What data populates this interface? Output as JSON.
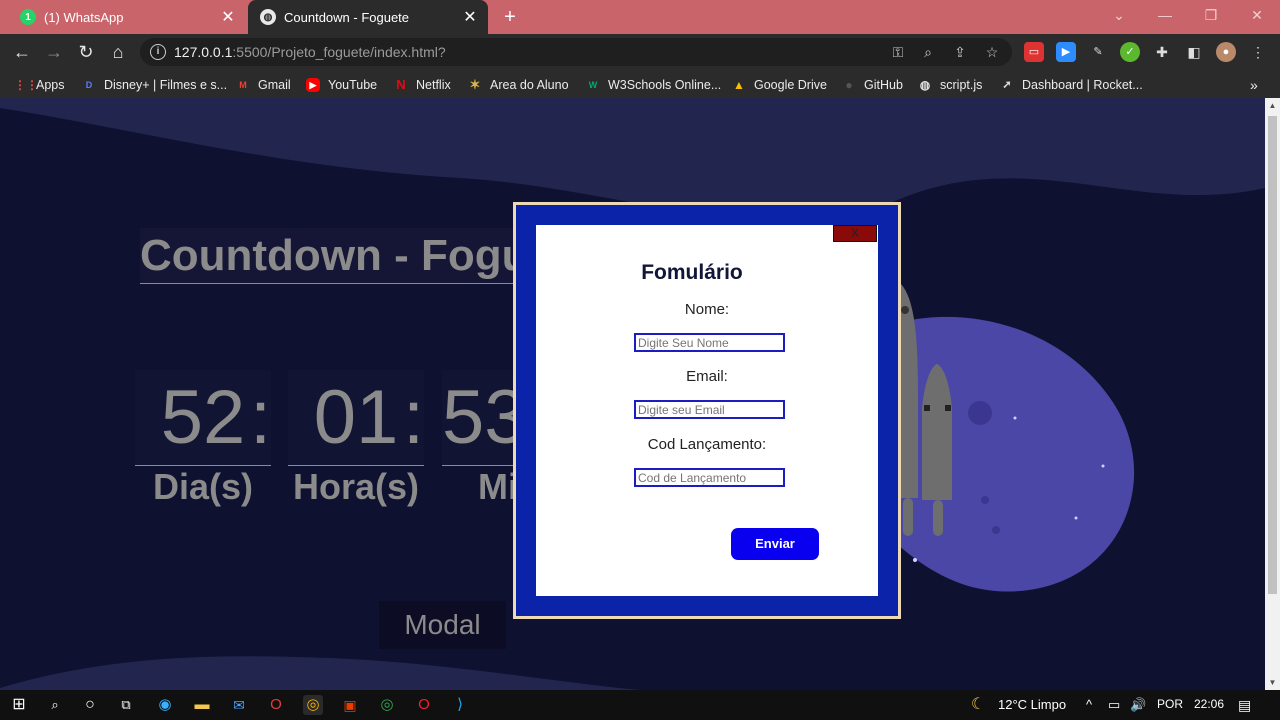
{
  "browser": {
    "tabs": [
      {
        "title": "(1) WhatsApp",
        "icon": "whatsapp-icon",
        "active": false
      },
      {
        "title": "Countdown - Foguete",
        "icon": "globe-icon",
        "active": true
      }
    ],
    "address": {
      "host": "127.0.0.1",
      "path": ":5500/Projeto_foguete/index.html?"
    },
    "bookmarks": [
      {
        "label": "Apps",
        "icon": "apps-grid-icon"
      },
      {
        "label": "Disney+ | Filmes e s...",
        "icon": "disney-icon"
      },
      {
        "label": "Gmail",
        "icon": "gmail-icon"
      },
      {
        "label": "YouTube",
        "icon": "youtube-icon"
      },
      {
        "label": "Netflix",
        "icon": "netflix-icon"
      },
      {
        "label": "Area do Aluno",
        "icon": "star-icon"
      },
      {
        "label": "W3Schools Online...",
        "icon": "w3schools-icon"
      },
      {
        "label": "Google Drive",
        "icon": "google-drive-icon"
      },
      {
        "label": "GitHub",
        "icon": "github-icon"
      },
      {
        "label": "script.js",
        "icon": "globe-icon"
      },
      {
        "label": "Dashboard | Rocket...",
        "icon": "rocket-icon"
      }
    ]
  },
  "page": {
    "title": "Countdown - Fogu",
    "countdown": {
      "days": "52",
      "hours": "01",
      "minutes": "53",
      "separator": ":",
      "labels": {
        "days": "Dia(s)",
        "hours": "Hora(s)",
        "minutes": "Mi"
      }
    },
    "modal_button": "Modal"
  },
  "modal": {
    "close": "X",
    "title": "Fomulário",
    "fields": [
      {
        "label": "Nome:",
        "placeholder": "Digite Seu Nome"
      },
      {
        "label": "Email:",
        "placeholder": "Digite seu Email"
      },
      {
        "label": "Cod Lançamento:",
        "placeholder": "Cod de Lançamento"
      }
    ],
    "submit": "Enviar"
  },
  "taskbar": {
    "weather": "12°C  Limpo",
    "language": "POR",
    "time": "22:06"
  },
  "colors": {
    "page_bg": "#0f1130",
    "modal_border": "#0a23a8",
    "submit": "#0a00f0",
    "close": "#8a0a0a",
    "tabstrip": "#c9646a"
  }
}
